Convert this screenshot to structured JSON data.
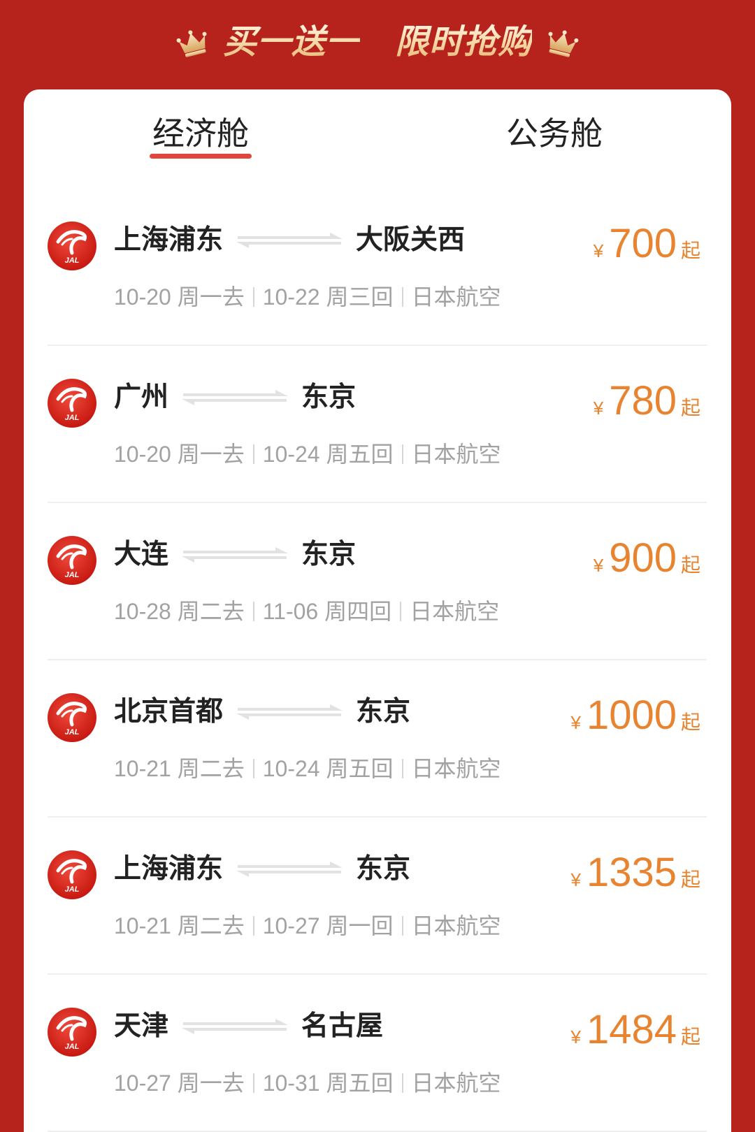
{
  "banner": {
    "left": "买一送一",
    "right": "限时抢购"
  },
  "tabs": [
    {
      "label": "经济舱",
      "active": true
    },
    {
      "label": "公务舱",
      "active": false
    }
  ],
  "logo_text": "JAL",
  "flights": [
    {
      "origin": "上海浦东",
      "destination": "大阪关西",
      "depart": "10-20 周一去",
      "return": "10-22 周三回",
      "airline": "日本航空",
      "currency": "¥",
      "price": "700",
      "suffix": "起"
    },
    {
      "origin": "广州",
      "destination": "东京",
      "depart": "10-20 周一去",
      "return": "10-24 周五回",
      "airline": "日本航空",
      "currency": "¥",
      "price": "780",
      "suffix": "起"
    },
    {
      "origin": "大连",
      "destination": "东京",
      "depart": "10-28 周二去",
      "return": "11-06 周四回",
      "airline": "日本航空",
      "currency": "¥",
      "price": "900",
      "suffix": "起"
    },
    {
      "origin": "北京首都",
      "destination": "东京",
      "depart": "10-21 周二去",
      "return": "10-24 周五回",
      "airline": "日本航空",
      "currency": "¥",
      "price": "1000",
      "suffix": "起"
    },
    {
      "origin": "上海浦东",
      "destination": "东京",
      "depart": "10-21 周二去",
      "return": "10-27 周一回",
      "airline": "日本航空",
      "currency": "¥",
      "price": "1335",
      "suffix": "起"
    },
    {
      "origin": "天津",
      "destination": "名古屋",
      "depart": "10-27 周一去",
      "return": "10-31 周五回",
      "airline": "日本航空",
      "currency": "¥",
      "price": "1484",
      "suffix": "起"
    }
  ],
  "colors": {
    "background": "#b5231c",
    "card": "#ffffff",
    "tab_underline": "#e0463b",
    "price": "#e8832f",
    "muted_text": "#a2a2a2",
    "banner_gold": "#f7dcae"
  },
  "icons": [
    "crown-icon",
    "jal-logo-icon",
    "round-trip-arrow-icon"
  ]
}
